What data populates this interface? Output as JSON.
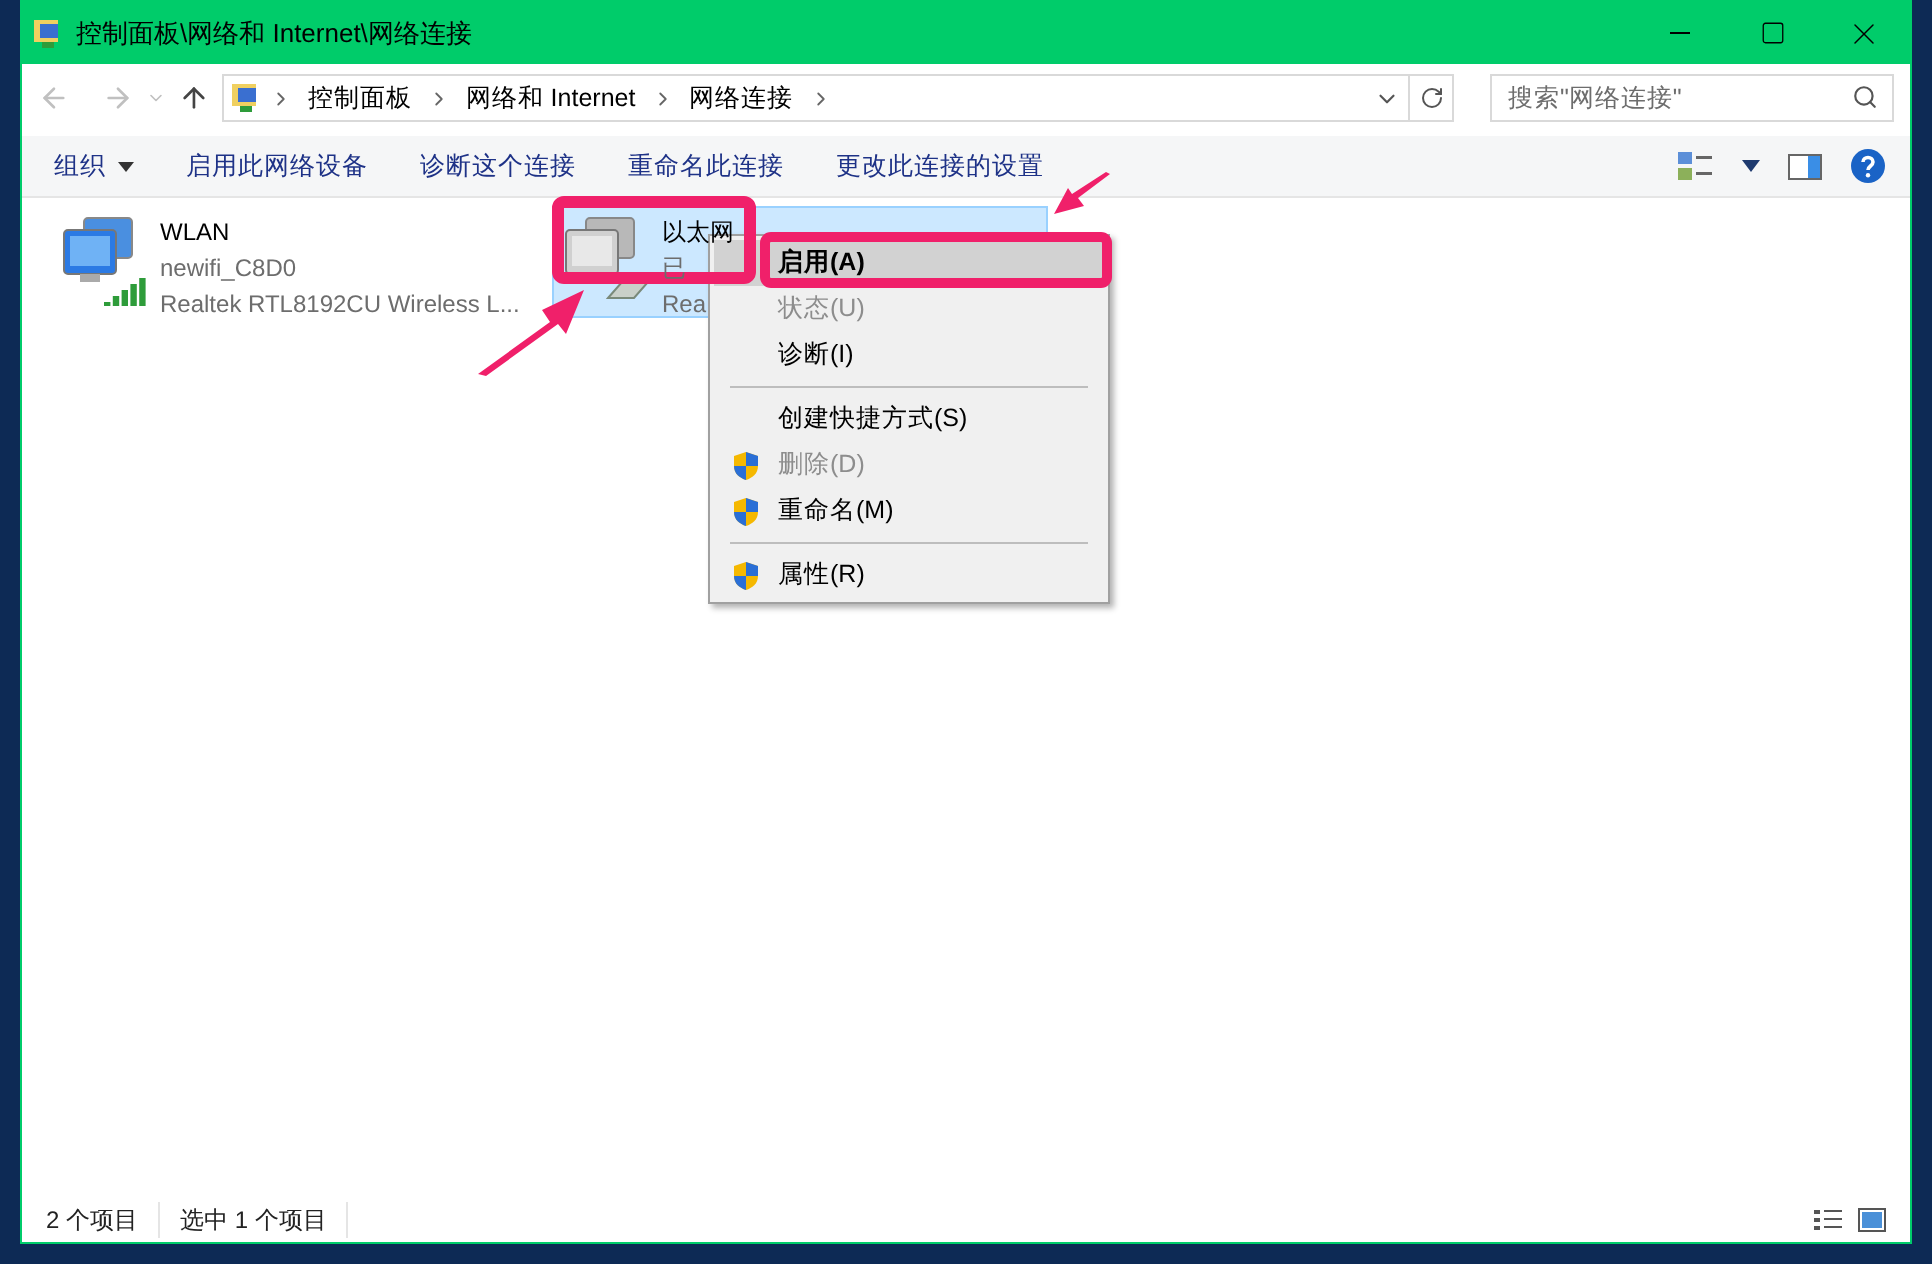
{
  "window": {
    "title": "控制面板\\网络和 Internet\\网络连接"
  },
  "address_bar": {
    "crumbs": [
      "控制面板",
      "网络和 Internet",
      "网络连接"
    ]
  },
  "search": {
    "placeholder": "搜索\"网络连接\""
  },
  "toolbar": {
    "items": [
      {
        "label": "组织",
        "dropdown": true
      },
      {
        "label": "启用此网络设备",
        "dropdown": false
      },
      {
        "label": "诊断这个连接",
        "dropdown": false
      },
      {
        "label": "重命名此连接",
        "dropdown": false
      },
      {
        "label": "更改此连接的设置",
        "dropdown": false
      }
    ]
  },
  "connections": [
    {
      "kind": "wireless",
      "name": "WLAN",
      "status": "newifi_C8D0",
      "device": "Realtek RTL8192CU Wireless L...",
      "selected": false
    },
    {
      "kind": "ethernet",
      "name": "以太网",
      "status": "已",
      "device": "Rea",
      "selected": true
    }
  ],
  "context_menu": [
    {
      "kind": "item",
      "label": "启用(A)",
      "default": true,
      "selected": true,
      "disabled": false,
      "shield": false
    },
    {
      "kind": "item",
      "label": "状态(U)",
      "default": false,
      "selected": false,
      "disabled": true,
      "shield": false
    },
    {
      "kind": "item",
      "label": "诊断(I)",
      "default": false,
      "selected": false,
      "disabled": false,
      "shield": false
    },
    {
      "kind": "separator"
    },
    {
      "kind": "item",
      "label": "创建快捷方式(S)",
      "default": false,
      "selected": false,
      "disabled": false,
      "shield": false
    },
    {
      "kind": "item",
      "label": "删除(D)",
      "default": false,
      "selected": false,
      "disabled": true,
      "shield": true
    },
    {
      "kind": "item",
      "label": "重命名(M)",
      "default": false,
      "selected": false,
      "disabled": false,
      "shield": true
    },
    {
      "kind": "separator"
    },
    {
      "kind": "item",
      "label": "属性(R)",
      "default": false,
      "selected": false,
      "disabled": false,
      "shield": true
    }
  ],
  "status_bar": {
    "items": [
      "2 个项目",
      "选中 1 个项目"
    ]
  }
}
